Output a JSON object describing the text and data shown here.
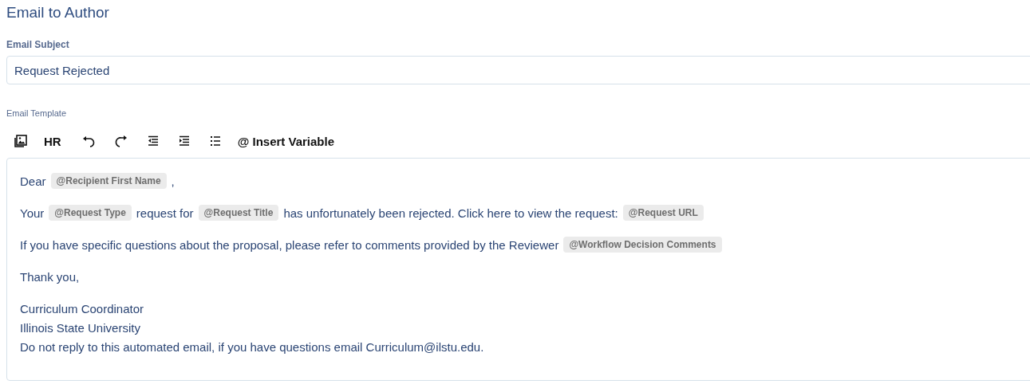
{
  "title": "Email to Author",
  "subject": {
    "label": "Email Subject",
    "value": "Request Rejected"
  },
  "template": {
    "label": "Email Template",
    "toolbar": [
      {
        "kind": "image"
      },
      {
        "kind": "text",
        "label": "HR"
      },
      {
        "kind": "undo"
      },
      {
        "kind": "redo"
      },
      {
        "kind": "outdent"
      },
      {
        "kind": "indent"
      },
      {
        "kind": "list"
      },
      {
        "kind": "text",
        "label": "@ Insert Variable"
      }
    ],
    "paragraphs": [
      {
        "lines": [
          [
            {
              "kind": "text",
              "text": "Dear"
            },
            {
              "kind": "variable",
              "text": "@Recipient First Name"
            },
            {
              "kind": "text",
              "text": ","
            }
          ]
        ]
      },
      {
        "lines": [
          [
            {
              "kind": "text",
              "text": "Your"
            },
            {
              "kind": "variable",
              "text": "@Request Type"
            },
            {
              "kind": "text",
              "text": "request for"
            },
            {
              "kind": "variable",
              "text": "@Request Title"
            },
            {
              "kind": "text",
              "text": "has unfortunately been rejected. Click here to view the request:"
            },
            {
              "kind": "variable",
              "text": "@Request URL"
            }
          ]
        ]
      },
      {
        "lines": [
          [
            {
              "kind": "text",
              "text": "If you have specific questions about the proposal, please refer to comments provided by the Reviewer"
            },
            {
              "kind": "variable",
              "text": "@Workflow Decision Comments"
            }
          ]
        ]
      },
      {
        "lines": [
          [
            {
              "kind": "text",
              "text": "Thank you,"
            }
          ]
        ]
      },
      {
        "lines": [
          [
            {
              "kind": "text",
              "text": "Curriculum Coordinator"
            }
          ],
          [
            {
              "kind": "text",
              "text": "Illinois State University"
            }
          ],
          [
            {
              "kind": "text",
              "text": "Do not reply to this automated email, if you have questions email Curriculum@ilstu.edu."
            }
          ]
        ]
      }
    ]
  }
}
